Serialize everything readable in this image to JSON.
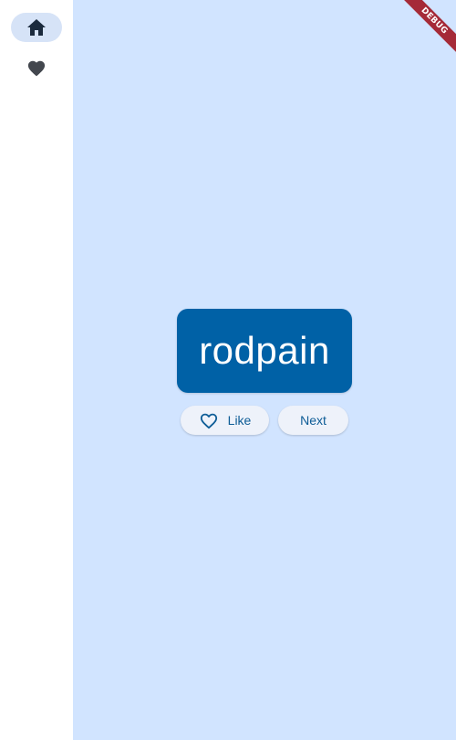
{
  "navigation_rail": {
    "items": [
      {
        "icon": "home-icon",
        "selected": true
      },
      {
        "icon": "heart-icon",
        "selected": false
      }
    ],
    "selected_color": "#d6e3f7"
  },
  "main": {
    "background": "#d1e4ff",
    "word_card": {
      "text": "rodpain",
      "color": "#0061a6"
    },
    "buttons": {
      "like_label": "Like",
      "like_icon": "heart-outline-icon",
      "next_label": "Next"
    }
  },
  "debug_banner": {
    "label": "DEBUG",
    "color": "#a52a38"
  }
}
